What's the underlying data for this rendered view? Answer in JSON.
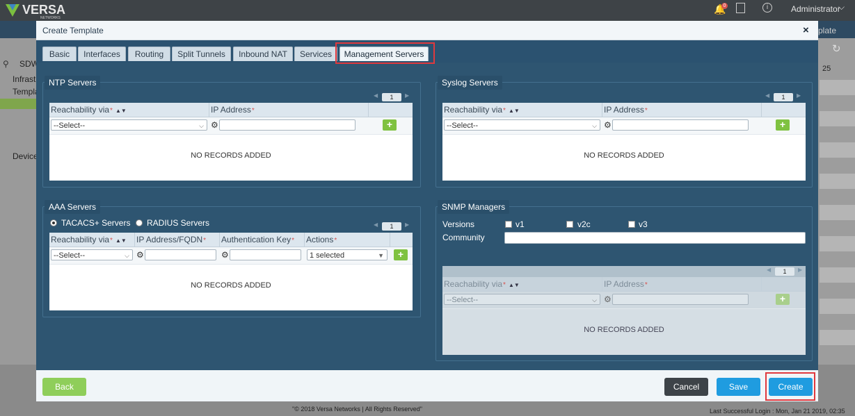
{
  "app": {
    "brand": "VERSA",
    "brand_sub": "NETWORKS",
    "notification_count": "0",
    "user": "Administrator",
    "user_chevron": "⌵",
    "right_tab_fragment": "plate",
    "right_select_fragment": "25",
    "nav_items": [
      "SDW",
      "Infrast",
      "Templa",
      "Devices"
    ],
    "footer_copyright": "\"© 2018 Versa Networks | All Rights Reserved\"",
    "last_login": "Last Successful Login : Mon, Jan 21 2019, 02:35"
  },
  "modal": {
    "title": "Create Template",
    "close": "×",
    "tabs": [
      "Basic",
      "Interfaces",
      "Routing",
      "Split Tunnels",
      "Inbound NAT",
      "Services",
      "Management Servers"
    ],
    "active_tab": "Management Servers"
  },
  "ntp": {
    "title": "NTP Servers",
    "page": "1",
    "col_reach": "Reachability via",
    "col_ip": "IP Address",
    "select_placeholder": "--Select--",
    "empty": "NO RECORDS ADDED"
  },
  "syslog": {
    "title": "Syslog Servers",
    "page": "1",
    "col_reach": "Reachability via",
    "col_ip": "IP Address",
    "select_placeholder": "--Select--",
    "empty": "NO RECORDS ADDED"
  },
  "aaa": {
    "title": "AAA Servers",
    "radio_tacacs": "TACACS+ Servers",
    "radio_radius": "RADIUS Servers",
    "page": "1",
    "col_reach": "Reachability via",
    "col_ip": "IP Address/FQDN",
    "col_key": "Authentication Key",
    "col_actions": "Actions",
    "select_placeholder": "--Select--",
    "actions_value": "1 selected",
    "empty": "NO RECORDS ADDED"
  },
  "snmp": {
    "title": "SNMP Managers",
    "versions_label": "Versions",
    "v1": "v1",
    "v2c": "v2c",
    "v3": "v3",
    "community_label": "Community",
    "page": "1",
    "col_reach": "Reachability via",
    "col_ip": "IP Address",
    "select_placeholder": "--Select--",
    "empty": "NO RECORDS ADDED"
  },
  "footer": {
    "back": "Back",
    "cancel": "Cancel",
    "save": "Save",
    "create": "Create"
  },
  "colors": {
    "accent_blue": "#1f9ce0",
    "back_green": "#8fce5a",
    "cancel_dark": "#3d4348",
    "highlight_red": "#e0393e"
  }
}
